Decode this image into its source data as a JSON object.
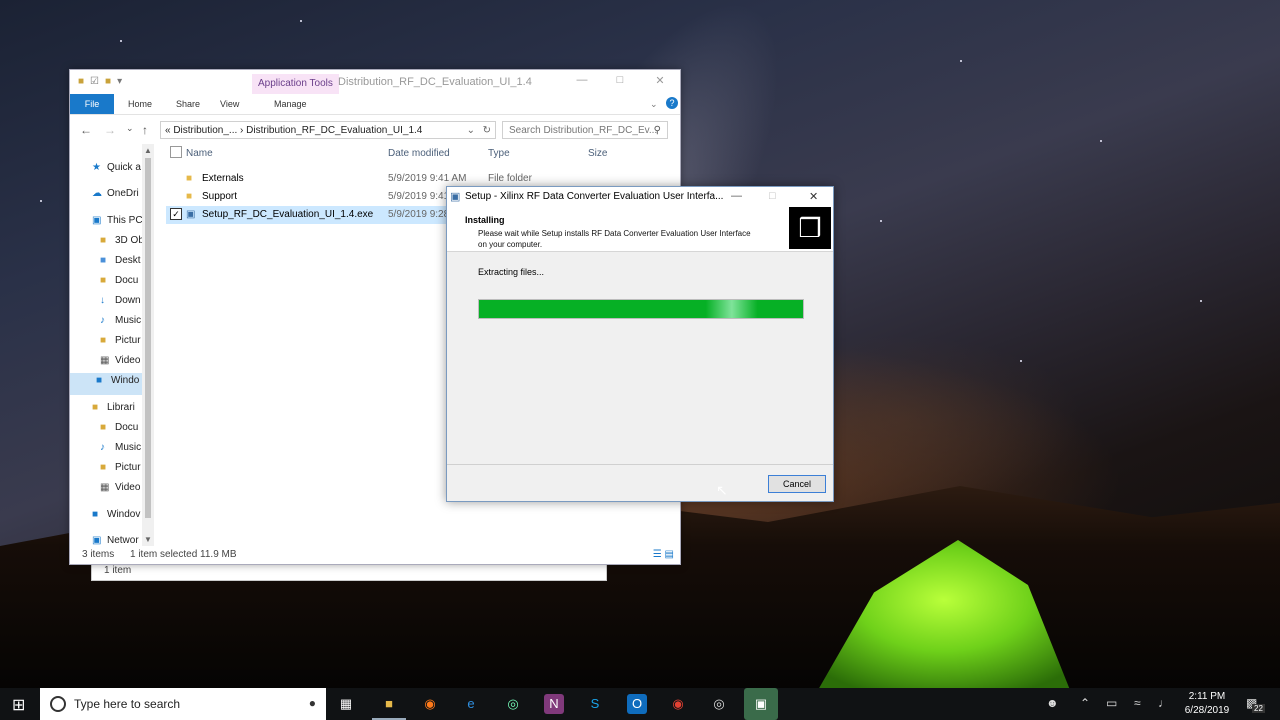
{
  "explorer": {
    "app_tools_label": "Application Tools",
    "window_title": "Distribution_RF_DC_Evaluation_UI_1.4",
    "ribbon_tabs": [
      "File",
      "Home",
      "Share",
      "View",
      "Manage"
    ],
    "help_label": "?",
    "address_path": "«  Distribution_...  ›  Distribution_RF_DC_Evaluation_UI_1.4",
    "search_placeholder": "Search Distribution_RF_DC_Ev...",
    "nav_items": [
      "Quick a",
      "OneDri",
      "This PC",
      "3D Ob",
      "Deskt",
      "Docu",
      "Down",
      "Music",
      "Pictur",
      "Video",
      "Windo",
      "Librari",
      "Docu",
      "Music",
      "Pictur",
      "Video",
      "Windov",
      "Networ"
    ],
    "columns": [
      "Name",
      "Date modified",
      "Type",
      "Size"
    ],
    "rows": [
      {
        "name": "Externals",
        "date": "5/9/2019 9:41 AM",
        "type": "File folder"
      },
      {
        "name": "Support",
        "date": "5/9/2019 9:41",
        "type": ""
      },
      {
        "name": "Setup_RF_DC_Evaluation_UI_1.4.exe",
        "date": "5/9/2019 9:28",
        "type": ""
      }
    ],
    "status_items": "3 items",
    "status_selected": "1 item selected  11.9 MB",
    "ghost_status": "1 item"
  },
  "setup": {
    "title": "Setup - Xilinx RF Data Converter Evaluation User Interfa...",
    "heading": "Installing",
    "description": "Please wait while Setup installs RF Data Converter Evaluation User Interface on your computer.",
    "status_message": "Extracting files...",
    "progress": 1.0,
    "progress_color": "#06b025",
    "cancel_label": "Cancel"
  },
  "taskbar": {
    "search_placeholder": "Type here to search",
    "time": "2:11 PM",
    "date": "6/28/2019",
    "notification_count": "22"
  }
}
